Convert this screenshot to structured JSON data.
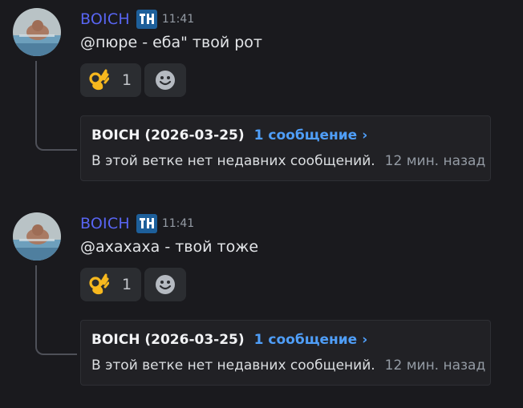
{
  "messages": [
    {
      "author": "BOICH",
      "time": "11:41",
      "text": "@пюре - еба\" твой рот",
      "reaction": {
        "emoji": "ok-hand-emoji",
        "count": "1"
      },
      "thread": {
        "name": "BOICH (2026-03-25)",
        "count_label": "1 сообщение",
        "chevron": "›",
        "empty_text": "В этой ветке нет недавних сообщений.",
        "ago": "12 мин. назад"
      }
    },
    {
      "author": "BOICH",
      "time": "11:41",
      "text": "@ахахаха - твой тоже",
      "reaction": {
        "emoji": "ok-hand-emoji",
        "count": "1"
      },
      "thread": {
        "name": "BOICH (2026-03-25)",
        "count_label": "1 сообщение",
        "chevron": "›",
        "empty_text": "В этой ветке нет недавних сообщений.",
        "ago": "12 мин. назад"
      }
    }
  ],
  "colors": {
    "background": "#1a1a1e",
    "username": "#5865f2",
    "link": "#4f9ef8",
    "muted": "#949ba4",
    "card": "#212125",
    "reaction_bg": "#2b2d31"
  },
  "icons": {
    "tag": "server-tag-icon",
    "add_reaction": "add-reaction-smiley-icon"
  }
}
